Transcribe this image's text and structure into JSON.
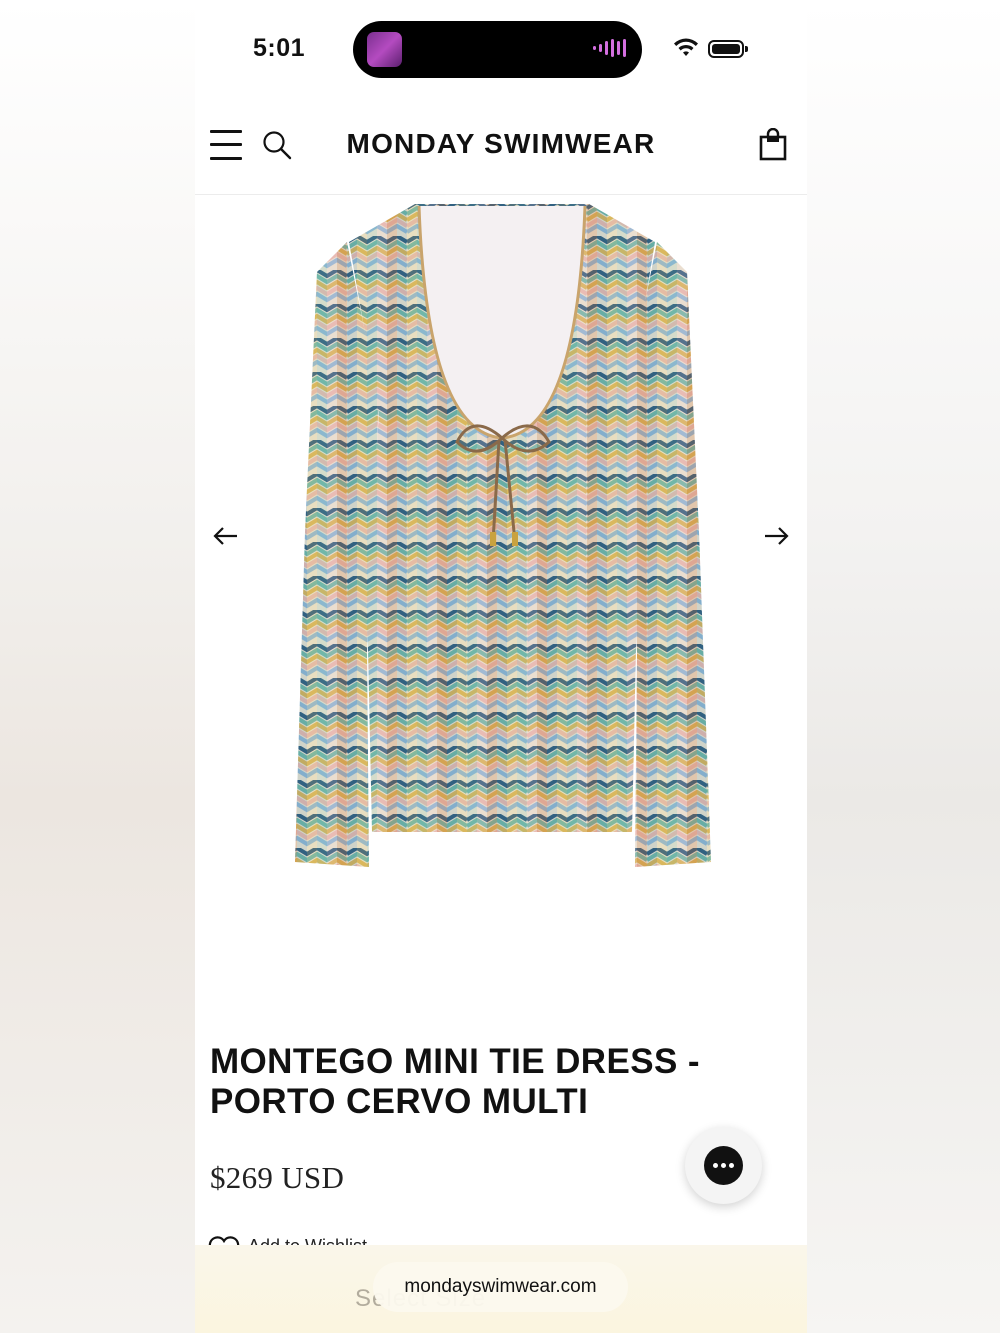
{
  "status_bar": {
    "time": "5:01"
  },
  "header": {
    "brand": "MONDAY SWIMWEAR"
  },
  "product": {
    "title_line1": "MONTEGO MINI TIE DRESS -",
    "title_line2": "PORTO CERVO MULTI",
    "price": "$269 USD",
    "wishlist_label": "Add to Wishlist"
  },
  "browser": {
    "url": "mondayswimwear.com",
    "bottom_text": "Select Size"
  },
  "colors": {
    "text": "#111111",
    "island_accent": "#d46fe0"
  }
}
